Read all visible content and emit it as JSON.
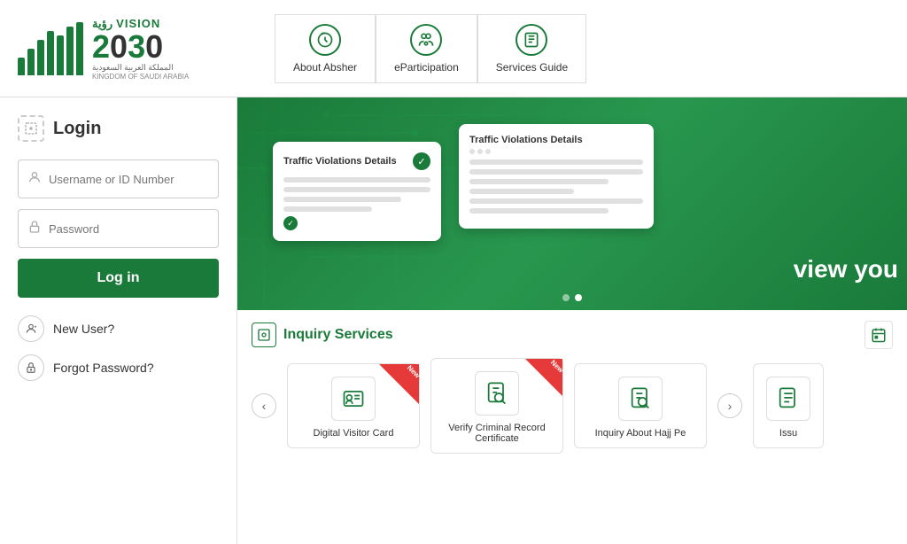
{
  "header": {
    "vision_arabic": "رؤية",
    "vision_label": "VISION",
    "year": "2030",
    "ksa_arabic": "المملكة العربية السعودية",
    "ksa_english": "KINGDOM OF SAUDI ARABIA",
    "nav": [
      {
        "id": "about-absher",
        "label": "About Absher",
        "icon": "↺"
      },
      {
        "id": "eparticipation",
        "label": "eParticipation",
        "icon": "👥"
      },
      {
        "id": "services-guide",
        "label": "Services Guide",
        "icon": "📖"
      }
    ]
  },
  "sidebar": {
    "login_title": "Login",
    "username_placeholder": "Username or ID Number",
    "password_placeholder": "Password",
    "login_button": "Log in",
    "new_user_label": "New User?",
    "forgot_password_label": "Forgot Password?"
  },
  "banner": {
    "card_title": "Traffic Violations Details",
    "card_title_back": "Traffic Violations Details",
    "view_text": "view you",
    "dots": [
      false,
      true
    ]
  },
  "services": {
    "section_title": "Inquiry Services",
    "cards": [
      {
        "id": "digital-visitor",
        "label": "Digital Visitor Card",
        "is_new": true,
        "icon": "🪪"
      },
      {
        "id": "verify-criminal",
        "label": "Verify Criminal Record Certificate",
        "is_new": true,
        "icon": "🔍"
      },
      {
        "id": "hajj-inquiry",
        "label": "Inquiry About Hajj Pe",
        "is_new": false,
        "icon": "📋"
      },
      {
        "id": "issu",
        "label": "Issu",
        "is_new": false,
        "icon": "📄"
      }
    ]
  }
}
